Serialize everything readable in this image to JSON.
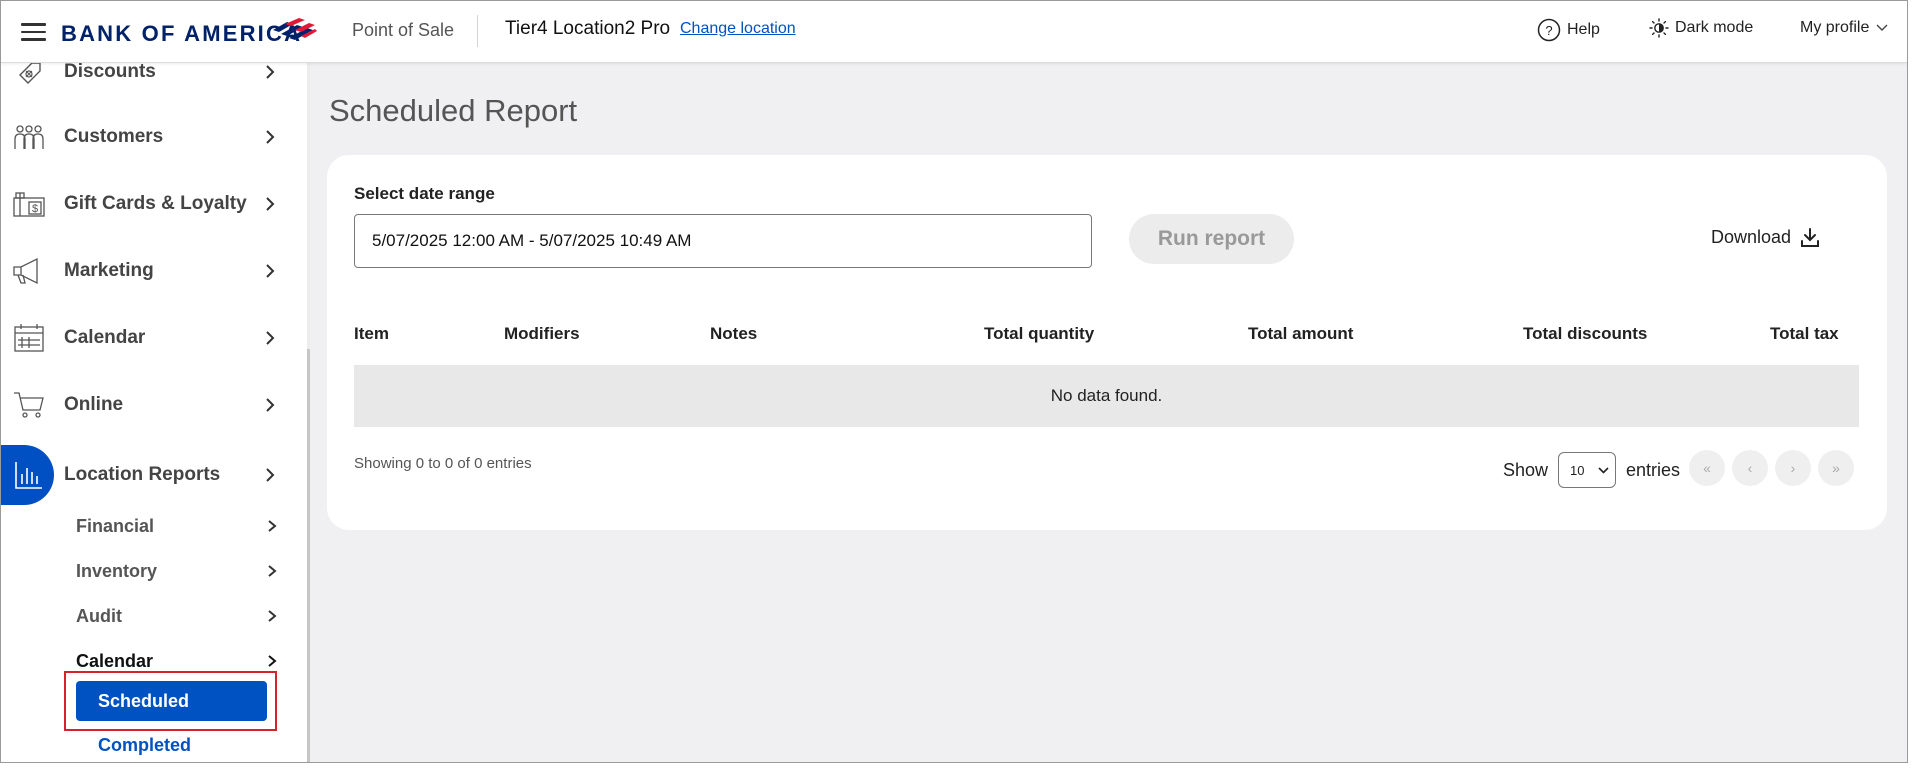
{
  "header": {
    "brand": "BANK OF AMERICA",
    "app_name": "Point of Sale",
    "location_name": "Tier4 Location2 Pro",
    "change_location": "Change location",
    "help": "Help",
    "dark_mode": "Dark mode",
    "profile": "My profile"
  },
  "sidebar": {
    "items": [
      {
        "label": "Discounts",
        "icon": "discount-tag-icon"
      },
      {
        "label": "Customers",
        "icon": "customers-group-icon"
      },
      {
        "label": "Gift Cards & Loyalty",
        "icon": "gift-card-icon"
      },
      {
        "label": "Marketing",
        "icon": "megaphone-icon"
      },
      {
        "label": "Calendar",
        "icon": "calendar-icon"
      },
      {
        "label": "Online",
        "icon": "shopping-cart-icon"
      },
      {
        "label": "Location Reports",
        "icon": "bar-chart-icon"
      }
    ],
    "sub_items": [
      {
        "label": "Financial"
      },
      {
        "label": "Inventory"
      },
      {
        "label": "Audit"
      },
      {
        "label": "Calendar"
      }
    ],
    "calendar_children": {
      "scheduled": "Scheduled",
      "completed": "Completed"
    }
  },
  "main": {
    "title": "Scheduled Report",
    "date_range_label": "Select date range",
    "date_range_value": "5/07/2025 12:00 AM - 5/07/2025 10:49 AM",
    "run_report": "Run report",
    "download": "Download",
    "table": {
      "columns": [
        "Item",
        "Modifiers",
        "Notes",
        "Total quantity",
        "Total amount",
        "Total discounts",
        "Total tax"
      ],
      "empty_message": "No data found."
    },
    "showing_text": "Showing 0 to 0 of 0 entries",
    "show_label": "Show",
    "entries_value": "10",
    "entries_label": "entries",
    "pagination": {
      "first": "«",
      "prev": "‹",
      "next": "›",
      "last": "»"
    }
  },
  "colors": {
    "brand_navy": "#012169",
    "brand_red": "#e31837",
    "accent_blue": "#0052c2",
    "highlight_red": "#d6222a"
  }
}
